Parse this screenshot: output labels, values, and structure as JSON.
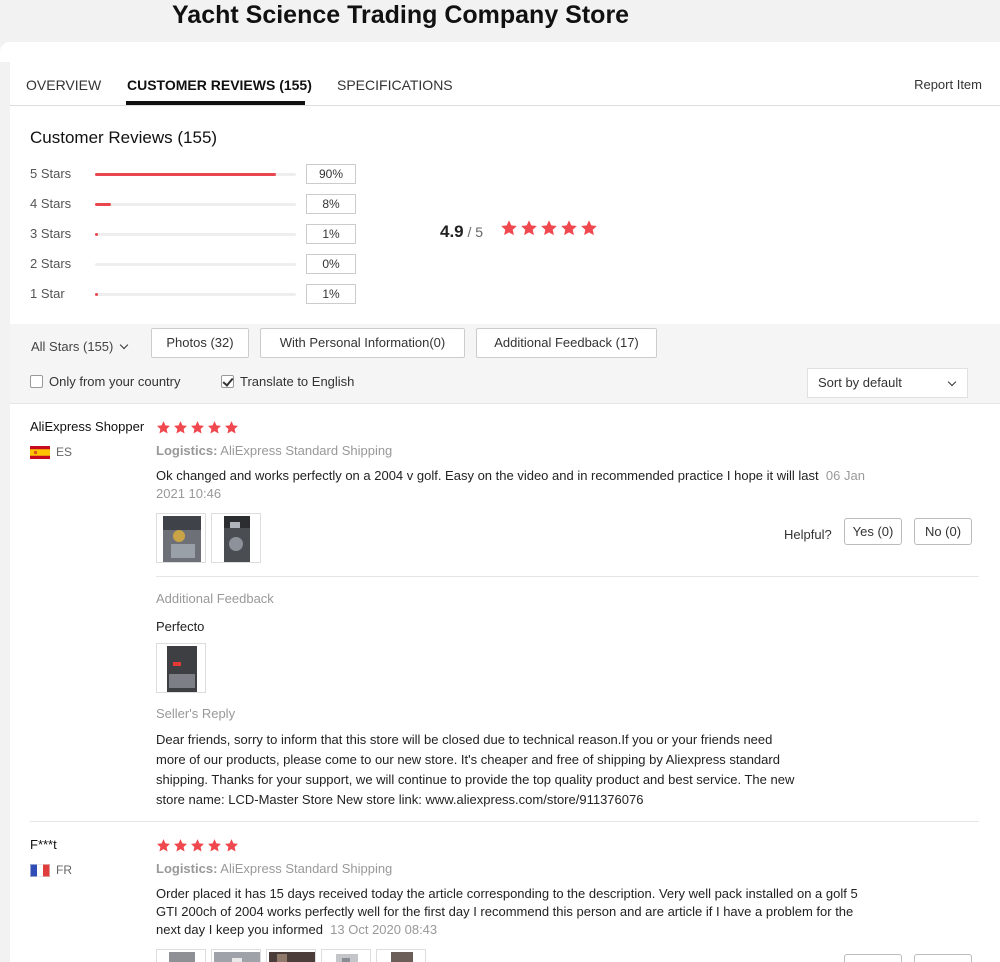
{
  "store": {
    "title": "Yacht Science Trading Company Store"
  },
  "tabs": [
    {
      "label": "OVERVIEW"
    },
    {
      "label": "CUSTOMER REVIEWS (155)",
      "active": true
    },
    {
      "label": "SPECIFICATIONS"
    }
  ],
  "report_label": "Report Item",
  "summary": {
    "title": "Customer Reviews (155)",
    "rows": [
      {
        "label": "5 Stars",
        "percent_text": "90%",
        "fraction": 0.9
      },
      {
        "label": "4 Stars",
        "percent_text": "8%",
        "fraction": 0.08
      },
      {
        "label": "3 Stars",
        "percent_text": "1%",
        "fraction": 0.01
      },
      {
        "label": "2 Stars",
        "percent_text": "0%",
        "fraction": 0.0
      },
      {
        "label": "1 Star",
        "percent_text": "1%",
        "fraction": 0.01
      }
    ],
    "average": "4.9",
    "average_max": " / 5",
    "average_stars": 5
  },
  "filters": {
    "all_stars": "All Stars (155)",
    "buttons": [
      "Photos (32)",
      "With Personal Information(0)",
      "Additional Feedback (17)"
    ],
    "only_country": "Only from your country",
    "only_country_checked": false,
    "translate": "Translate to English",
    "translate_checked": true,
    "sort": "Sort by default"
  },
  "colors": {
    "accent": "#e8474f",
    "star": "#f0484f"
  },
  "reviews": [
    {
      "author": "AliExpress Shopper",
      "country": "ES",
      "stars": 5,
      "logistics_label": "Logistics:",
      "logistics_value": " AliExpress Standard Shipping",
      "text": "Ok changed and works perfectly on a 2004 v golf. Easy on the video and in recommended practice I hope it will last",
      "date": "06 Jan 2021 10:46",
      "helpful_label": "Helpful?",
      "yes_label": "Yes (0)",
      "no_label": "No (0)",
      "additional_feedback_label": "Additional Feedback",
      "additional_feedback_text": "Perfecto",
      "seller_reply_label": "Seller's Reply",
      "seller_reply_lines": [
        "Dear friends, sorry to inform that this store will be closed due to technical reason.If you or your friends need",
        "more of our products, please come to our new store. It's cheaper and free of shipping by Aliexpress standard",
        "shipping. Thanks for your support, we will continue to provide the top quality product and best service. The new",
        "store name: LCD-Master Store New store link: www.aliexpress.com/store/911376076"
      ]
    },
    {
      "author": "F***t",
      "country": "FR",
      "stars": 5,
      "logistics_label": "Logistics:",
      "logistics_value": " AliExpress Standard Shipping",
      "text": "Order placed it has 15 days received today the article corresponding to the description. Very well pack installed on a golf 5 GTI 200ch of 2004 works perfectly well for the first day I recommend this person and are article if I have a problem for the next day I keep you informed",
      "date": "13 Oct 2020 08:43"
    }
  ]
}
